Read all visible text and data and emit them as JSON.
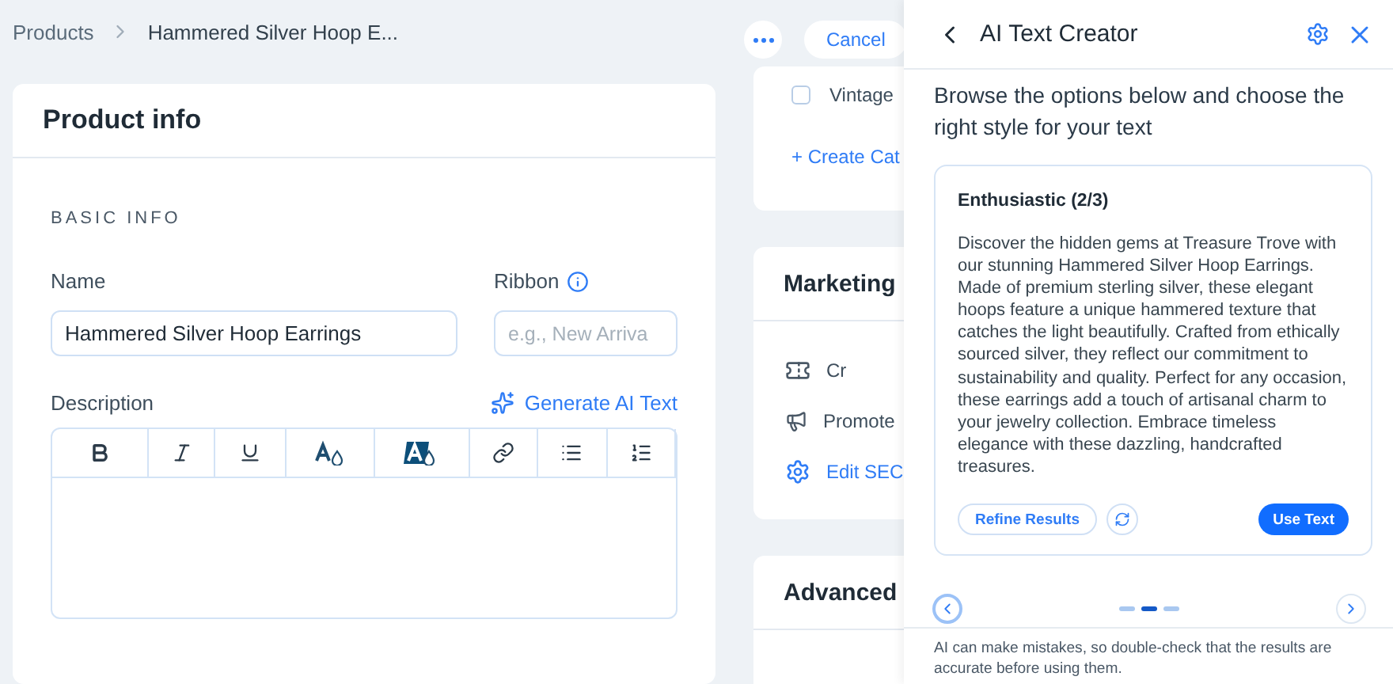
{
  "breadcrumbs": [
    "Products",
    "Hammered Silver Hoop E..."
  ],
  "product_info": {
    "title": "Product info",
    "section": "BASIC INFO",
    "name_label": "Name",
    "name_value": "Hammered Silver Hoop Earrings",
    "ribbon_label": "Ribbon",
    "ribbon_placeholder": "e.g., New Arriva",
    "description_label": "Description",
    "generate_link": "Generate AI Text",
    "toolbar": [
      {
        "kind": "bold"
      },
      {
        "kind": "italic"
      },
      {
        "kind": "underline"
      },
      {
        "kind": "text-color"
      },
      {
        "kind": "highlight"
      },
      {
        "kind": "link"
      },
      {
        "kind": "bulleted-list"
      },
      {
        "kind": "numbered-list"
      }
    ]
  },
  "actions": {
    "cancel": "Cancel"
  },
  "categories": {
    "items": [
      {
        "label": "Vintage",
        "checked": false
      }
    ],
    "create": "+ Create Cat"
  },
  "marketing": {
    "title": "Marketing",
    "items": [
      {
        "kind": "coupon",
        "label": "Cr"
      },
      {
        "kind": "promote",
        "label": "Promote"
      },
      {
        "kind": "seo",
        "label": "Edit SEC"
      }
    ]
  },
  "advanced": {
    "title": "Advanced"
  },
  "panel": {
    "title": "AI Text Creator",
    "intro": "Browse the options below and choose the right style for your text",
    "result": {
      "title": "Enthusiastic (2/3)",
      "text": "Discover the hidden gems at Treasure Trove with our stunning Hammered Silver Hoop Earrings. Made of premium sterling silver, these elegant hoops feature a unique hammered texture that catches the light beautifully. Crafted from ethically sourced silver, they reflect our commitment to sustainability and quality. Perfect for any occasion, these earrings add a touch of artisanal charm to your jewelry collection. Embrace timeless elegance with these dazzling, handcrafted treasures.",
      "refine": "Refine Results",
      "use": "Use Text"
    },
    "pages": [
      {
        "selected": false
      },
      {
        "selected": true
      },
      {
        "selected": false
      }
    ],
    "disclaimer": "AI can make mistakes, so double-check that the results are accurate before using them."
  }
}
